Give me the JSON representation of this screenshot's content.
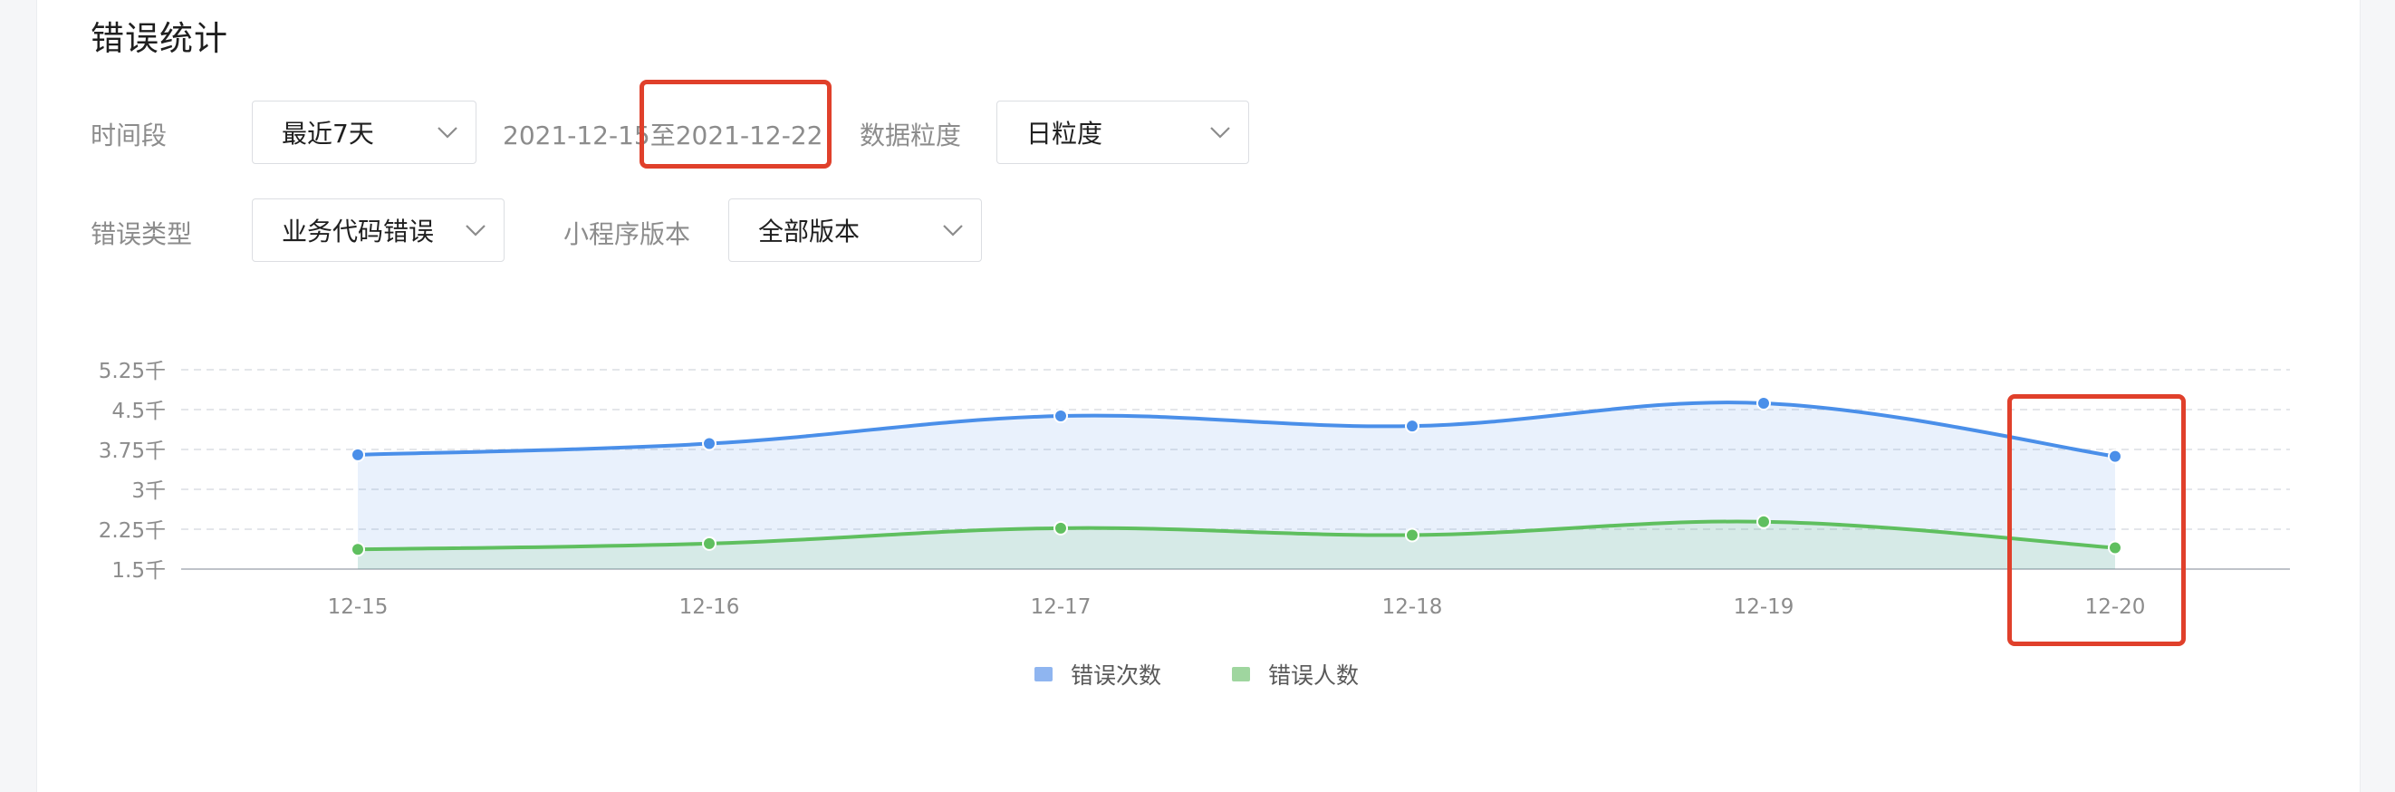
{
  "header": {
    "title": "错误统计"
  },
  "filters": {
    "period_label": "时间段",
    "period_value": "最近7天",
    "date_range": "2021-12-15至2021-12-22",
    "granularity_label": "数据粒度",
    "granularity_value": "日粒度",
    "error_type_label": "错误类型",
    "error_type_value": "业务代码错误",
    "version_label": "小程序版本",
    "version_value": "全部版本"
  },
  "colors": {
    "series1": "#4a8fe9",
    "series2": "#5fbf5f",
    "highlight": "#e0402b"
  },
  "chart_data": {
    "type": "area",
    "categories": [
      "12-15",
      "12-16",
      "12-17",
      "12-18",
      "12-19",
      "12-20"
    ],
    "y_ticks": [
      "1.5千",
      "2.25千",
      "3千",
      "3.75千",
      "4.5千",
      "5.25千"
    ],
    "y_tick_values": [
      1500,
      2250,
      3000,
      3750,
      4500,
      5250
    ],
    "ylim": [
      1500,
      5250
    ],
    "series": [
      {
        "name": "错误次数",
        "values": [
          3650,
          3860,
          4380,
          4190,
          4620,
          3620
        ]
      },
      {
        "name": "错误人数",
        "values": [
          1870,
          1980,
          2270,
          2140,
          2390,
          1900
        ]
      }
    ],
    "grid": true,
    "legend": "bottom-center"
  }
}
